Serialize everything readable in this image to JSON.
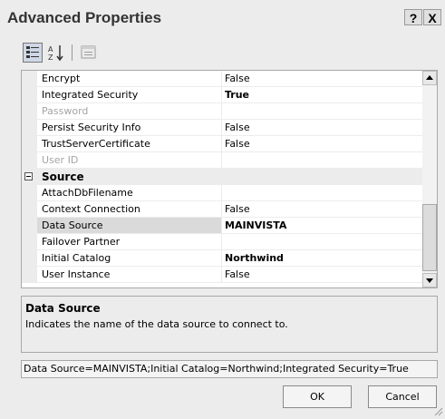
{
  "window": {
    "title": "Advanced Properties",
    "help_label": "?",
    "close_label": "X"
  },
  "toolbar": {
    "categorized_icon": "categorized-icon",
    "alphabetical_icon": "sort-alphabetical-icon",
    "property_pages_icon": "property-pages-icon"
  },
  "properties": [
    {
      "name": "Encrypt",
      "value": "False",
      "state": "normal"
    },
    {
      "name": "Integrated Security",
      "value": "True",
      "state": "bold"
    },
    {
      "name": "Password",
      "value": "",
      "state": "disabled"
    },
    {
      "name": "Persist Security Info",
      "value": "False",
      "state": "normal"
    },
    {
      "name": "TrustServerCertificate",
      "value": "False",
      "state": "normal"
    },
    {
      "name": "User ID",
      "value": "",
      "state": "disabled"
    },
    {
      "name": "Source",
      "value": "",
      "state": "category"
    },
    {
      "name": "AttachDbFilename",
      "value": "",
      "state": "normal"
    },
    {
      "name": "Context Connection",
      "value": "False",
      "state": "normal"
    },
    {
      "name": "Data Source",
      "value": "MAINVISTA",
      "state": "selected"
    },
    {
      "name": "Failover Partner",
      "value": "",
      "state": "normal"
    },
    {
      "name": "Initial Catalog",
      "value": "Northwind",
      "state": "bold"
    },
    {
      "name": "User Instance",
      "value": "False",
      "state": "normal"
    }
  ],
  "description": {
    "title": "Data Source",
    "text": "Indicates the name of the data source to connect to."
  },
  "connection_string": "Data Source=MAINVISTA;Initial Catalog=Northwind;Integrated Security=True",
  "buttons": {
    "ok": "OK",
    "cancel": "Cancel"
  }
}
